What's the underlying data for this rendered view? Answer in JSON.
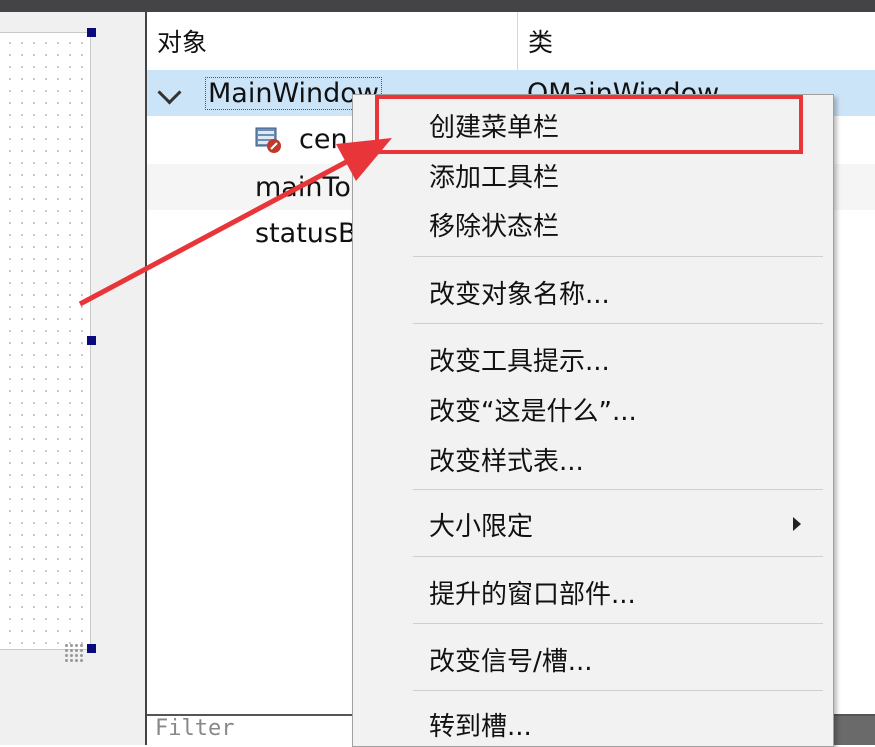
{
  "inspector": {
    "col_object": "对象",
    "col_class": "类",
    "rows": [
      {
        "name": "MainWindow",
        "class": "QMainWindow"
      },
      {
        "name": "cen",
        "class": ""
      },
      {
        "name": "mainTo",
        "class": ""
      },
      {
        "name": "statusB",
        "class": ""
      }
    ],
    "filter_placeholder": "Filter"
  },
  "context_menu": {
    "items": [
      "创建菜单栏",
      "添加工具栏",
      "移除状态栏",
      "改变对象名称...",
      "改变工具提示...",
      "改变“这是什么”...",
      "改变样式表...",
      "大小限定",
      "提升的窗口部件...",
      "改变信号/槽...",
      "转到槽..."
    ]
  },
  "colors": {
    "selection": "#cce4f7",
    "annotation_red": "#e8353a",
    "handle": "#0a0a7a"
  },
  "icons": [
    "chevron-down-icon",
    "central-widget-icon",
    "submenu-arrow-icon",
    "annotation-arrow"
  ]
}
